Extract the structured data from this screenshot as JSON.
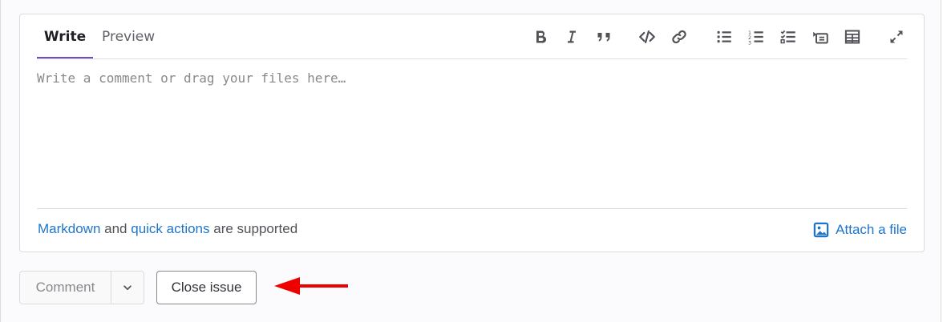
{
  "tabs": {
    "write": "Write",
    "preview": "Preview"
  },
  "toolbar": [
    {
      "name": "bold-icon"
    },
    {
      "name": "italic-icon"
    },
    {
      "name": "quote-icon"
    },
    {
      "name": "code-icon"
    },
    {
      "name": "link-icon"
    },
    {
      "name": "bullet-list-icon"
    },
    {
      "name": "numbered-list-icon"
    },
    {
      "name": "task-list-icon"
    },
    {
      "name": "collapsible-section-icon"
    },
    {
      "name": "table-icon"
    },
    {
      "name": "fullscreen-icon"
    }
  ],
  "editor": {
    "placeholder": "Write a comment or drag your files here…",
    "value": ""
  },
  "footer": {
    "markdown_link": "Markdown",
    "and_text": " and ",
    "quick_actions_link": "quick actions",
    "supported_text": " are supported",
    "attach_label": "Attach a file"
  },
  "actions": {
    "comment": "Comment",
    "close_issue": "Close issue"
  },
  "colors": {
    "accent": "#6b4fbb",
    "link": "#1f75cb",
    "annotation_arrow": "#ee0000"
  }
}
